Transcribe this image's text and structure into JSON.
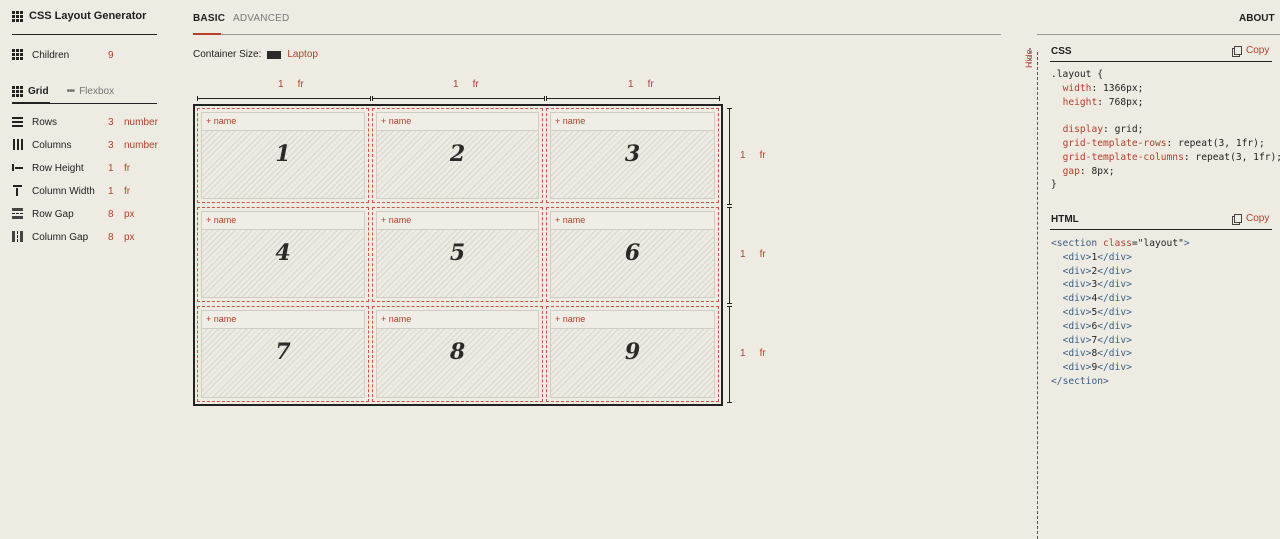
{
  "app": {
    "title": "CSS Layout Generator"
  },
  "children": {
    "label": "Children",
    "value": "9"
  },
  "layout_tabs": [
    {
      "label": "Grid",
      "active": true
    },
    {
      "label": "Flexbox",
      "active": false
    }
  ],
  "properties": [
    {
      "label": "Rows",
      "value": "3",
      "unit": "number"
    },
    {
      "label": "Columns",
      "value": "3",
      "unit": "number"
    },
    {
      "label": "Row Height",
      "value": "1",
      "unit": "fr"
    },
    {
      "label": "Column Width",
      "value": "1",
      "unit": "fr"
    },
    {
      "label": "Row Gap",
      "value": "8",
      "unit": "px"
    },
    {
      "label": "Column Gap",
      "value": "8",
      "unit": "px"
    }
  ],
  "main_tabs": [
    {
      "label": "BASIC",
      "active": true
    },
    {
      "label": "ADVANCED",
      "active": false
    }
  ],
  "container": {
    "label": "Container Size:",
    "value": "Laptop"
  },
  "column_sizes": [
    {
      "value": "1",
      "unit": "fr"
    },
    {
      "value": "1",
      "unit": "fr"
    },
    {
      "value": "1",
      "unit": "fr"
    }
  ],
  "row_sizes": [
    {
      "value": "1",
      "unit": "fr"
    },
    {
      "value": "1",
      "unit": "fr"
    },
    {
      "value": "1",
      "unit": "fr"
    }
  ],
  "cells": [
    {
      "name_label": "+ name",
      "number": "1"
    },
    {
      "name_label": "+ name",
      "number": "2"
    },
    {
      "name_label": "+ name",
      "number": "3"
    },
    {
      "name_label": "+ name",
      "number": "4"
    },
    {
      "name_label": "+ name",
      "number": "5"
    },
    {
      "name_label": "+ name",
      "number": "6"
    },
    {
      "name_label": "+ name",
      "number": "7"
    },
    {
      "name_label": "+ name",
      "number": "8"
    },
    {
      "name_label": "+ name",
      "number": "9"
    }
  ],
  "about_label": "ABOUT",
  "hide_label": "Hide",
  "css_panel": {
    "title": "CSS",
    "copy_label": "Copy",
    "selector": ".layout",
    "declarations": [
      {
        "prop": "width",
        "value": "1366px"
      },
      {
        "prop": "height",
        "value": "768px"
      },
      {
        "prop": "display",
        "value": "grid"
      },
      {
        "prop": "grid-template-rows",
        "value": "repeat(3, 1fr)"
      },
      {
        "prop": "grid-template-columns",
        "value": "repeat(3, 1fr)"
      },
      {
        "prop": "gap",
        "value": "8px"
      }
    ]
  },
  "html_panel": {
    "title": "HTML",
    "copy_label": "Copy",
    "section_tag": "section",
    "class_attr": "class",
    "class_value": "\"layout\"",
    "child_tag": "div",
    "items": [
      "1",
      "2",
      "3",
      "4",
      "5",
      "6",
      "7",
      "8",
      "9"
    ]
  },
  "colors": {
    "accent": "#b5402c",
    "background": "#edebe2",
    "ink": "#1f1f1f",
    "code_tag": "#3a5f86"
  }
}
